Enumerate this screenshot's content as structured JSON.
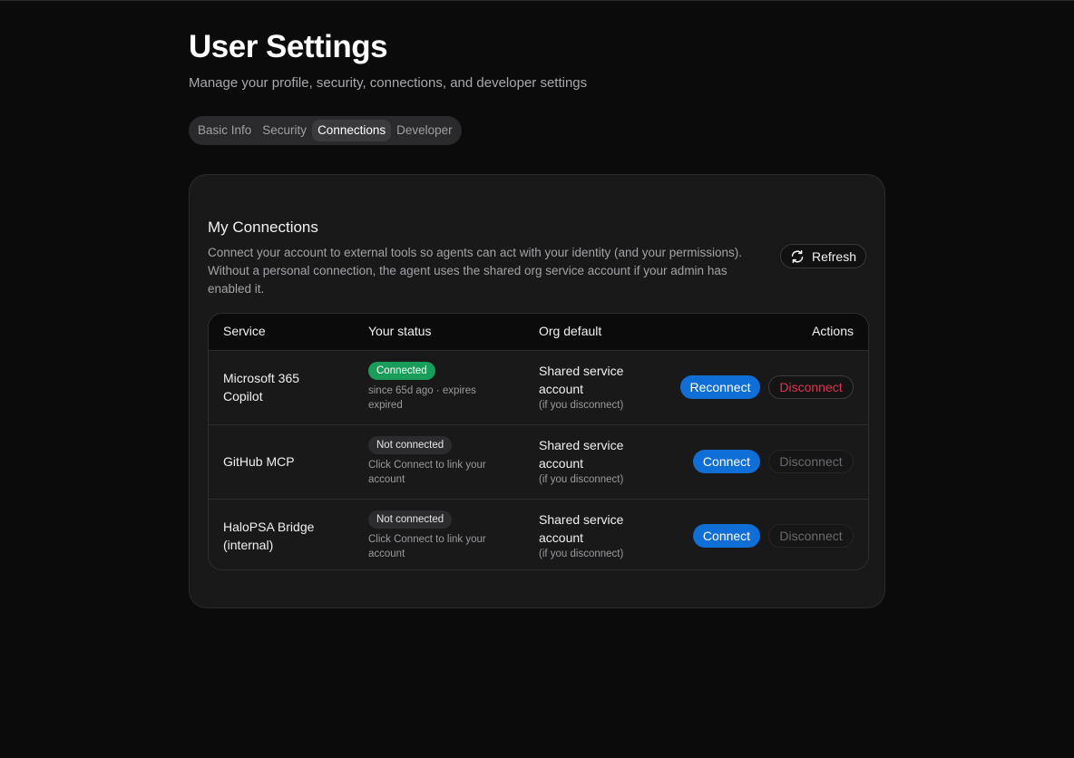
{
  "page": {
    "title": "User Settings",
    "subtitle": "Manage your profile, security, connections, and developer settings"
  },
  "tabs": [
    {
      "label": "Basic Info",
      "active": false
    },
    {
      "label": "Security",
      "active": false
    },
    {
      "label": "Connections",
      "active": true
    },
    {
      "label": "Developer",
      "active": false
    }
  ],
  "connections": {
    "title": "My Connections",
    "description": "Connect your account to external tools so agents can act with your identity (and your permissions). Without a personal connection, the agent uses the shared org service account if your admin has enabled it.",
    "refresh_label": "Refresh",
    "refresh_icon": "refresh-icon",
    "columns": {
      "service": "Service",
      "status": "Your status",
      "org_default": "Org default",
      "actions": "Actions"
    },
    "rows": [
      {
        "service": "Microsoft 365 Copilot",
        "status_badge": "Connected",
        "status_note": "since 65d ago · expires expired",
        "org_main": "Shared service account",
        "org_note": "(if you disconnect)",
        "primary_action": "Reconnect",
        "secondary_action": "Disconnect"
      },
      {
        "service": "GitHub MCP",
        "status_badge": "Not connected",
        "status_note": "Click Connect to link your account",
        "org_main": "Shared service account",
        "org_note": "(if you disconnect)",
        "primary_action": "Connect",
        "secondary_action": "Disconnect"
      },
      {
        "service": "HaloPSA Bridge (internal)",
        "status_badge": "Not connected",
        "status_note": "Click Connect to link your account",
        "org_main": "Shared service account",
        "org_note": "(if you disconnect)",
        "primary_action": "Connect",
        "secondary_action": "Disconnect"
      }
    ]
  },
  "colors": {
    "background": "#0b0b0c",
    "card": "#19191a",
    "primary": "#0f6fd6",
    "success": "#1a9c5a",
    "danger": "#e0334f"
  }
}
